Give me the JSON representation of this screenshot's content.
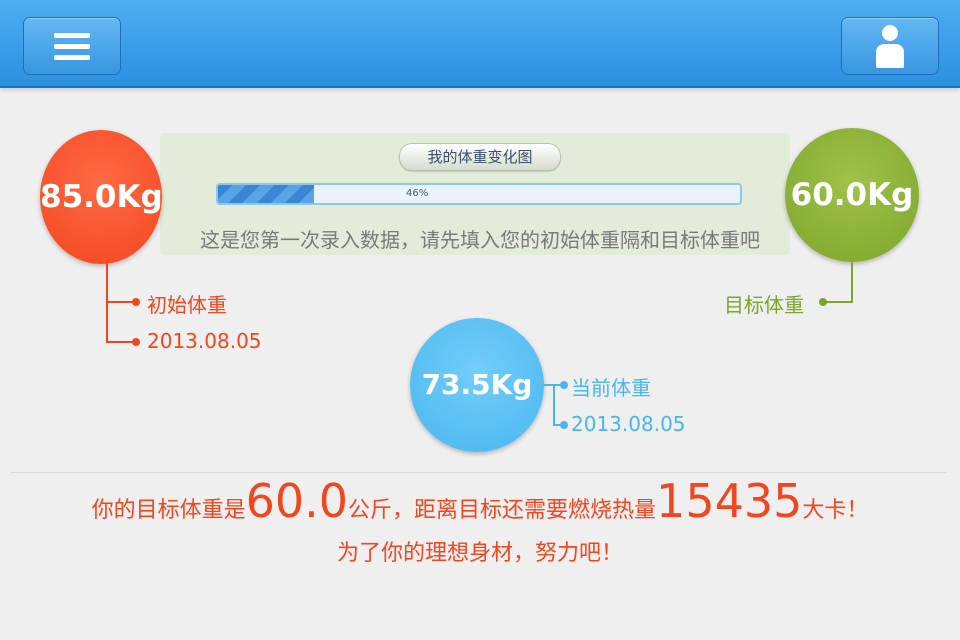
{
  "header": {
    "menu_icon": "menu-icon",
    "user_icon": "user-icon",
    "accent": "#2b8fe0"
  },
  "chart": {
    "title": "我的体重变化图",
    "progress_percent": 46,
    "progress_label": "46%",
    "hint": "这是您第一次录入数据，请先填入您的初始体重隔和目标体重吧"
  },
  "initial": {
    "weight": "85.0Kg",
    "label": "初始体重",
    "date": "2013.08.05",
    "color": "#f2461f"
  },
  "target": {
    "weight": "60.0Kg",
    "label": "目标体重",
    "color": "#7ea52b"
  },
  "current": {
    "weight": "73.5Kg",
    "label": "当前体重",
    "date": "2013.08.05",
    "color": "#48b6ef"
  },
  "summary": {
    "part1": "你的目标体重是",
    "target_value": "60.0",
    "part2": "公斤，距离目标还需要燃烧热量",
    "calories": "15435",
    "part3": "大卡！",
    "line2": "为了你的理想身材，努力吧！"
  }
}
